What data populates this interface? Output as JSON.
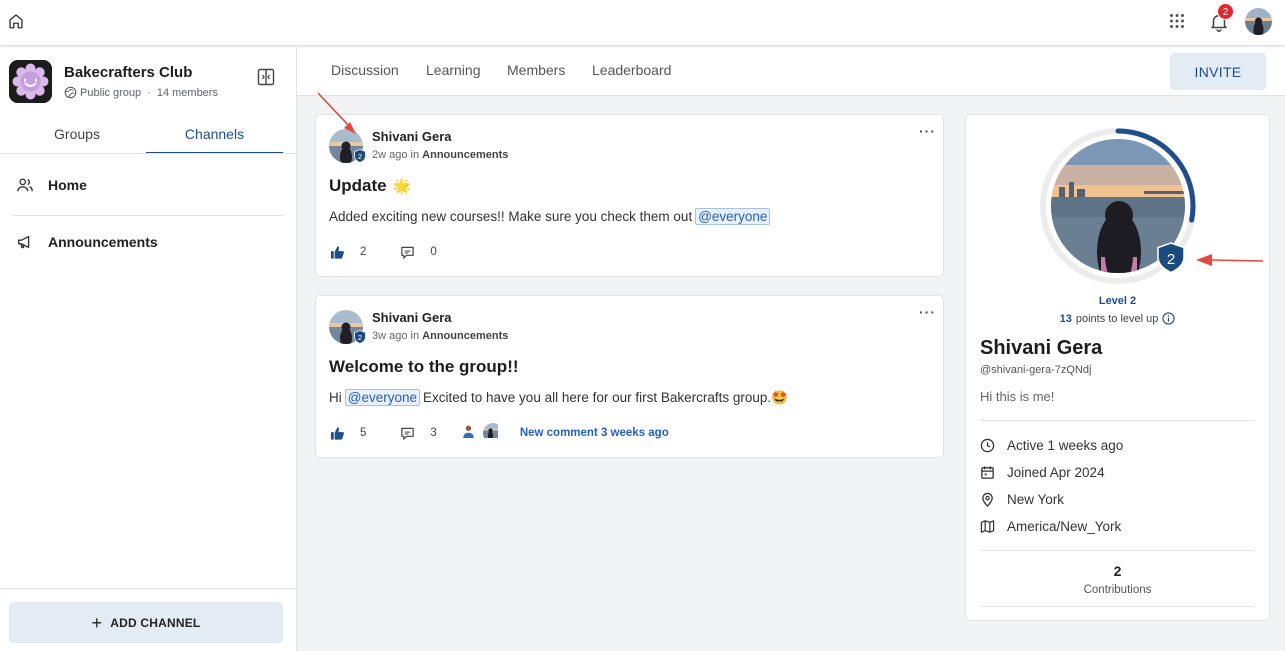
{
  "topbar": {
    "notification_count": "2"
  },
  "icons": {
    "home": "home-icon",
    "apps": "apps-grid-icon",
    "bell": "bell-icon",
    "globe": "globe-icon",
    "collapse": "collapse-panel-icon",
    "members": "users-icon",
    "announcements": "megaphone-icon",
    "like": "thumbs-up-icon",
    "comment": "comment-icon",
    "info": "info-icon",
    "activity": "clock-icon",
    "joined": "calendar-icon",
    "location": "location-pin-icon",
    "timezone": "map-icon"
  },
  "sidebar": {
    "club_name": "Bakecrafters Club",
    "privacy": "Public group",
    "dot": "·",
    "members": "14 members",
    "tabs": [
      {
        "label": "Groups"
      },
      {
        "label": "Channels",
        "active": true
      }
    ],
    "items": [
      {
        "label": "Home"
      },
      {
        "label": "Announcements"
      }
    ],
    "add_channel": "ADD CHANNEL",
    "add_symbol": "+"
  },
  "header": {
    "tabs": [
      {
        "label": "Discussion"
      },
      {
        "label": "Learning"
      },
      {
        "label": "Members"
      },
      {
        "label": "Leaderboard"
      }
    ],
    "invite": "INVITE"
  },
  "posts": [
    {
      "author": "Shivani Gera",
      "time": "2w ago",
      "in": "in",
      "channel": "Announcements",
      "title": "Update",
      "title_emoji": "🌟",
      "body_text": "Added exciting new courses!! Make sure you check them out",
      "mention": "@everyone",
      "likes": "2",
      "comments": "0",
      "more": "···",
      "badge_level": "2"
    },
    {
      "author": "Shivani Gera",
      "time": "3w ago",
      "in": "in",
      "channel": "Announcements",
      "title": "Welcome to the group!!",
      "body_prefix": "Hi",
      "mention": "@everyone",
      "body_text": "Excited to have you all here for our first Bakercrafts group.🤩",
      "likes": "5",
      "comments": "3",
      "new_comment": "New comment 3 weeks ago",
      "more": "···",
      "badge_level": "2"
    }
  ],
  "profile": {
    "badge_level": "2",
    "level": "Level 2",
    "points_number": "13",
    "points_text": "points to level up",
    "level_progress": 0.28,
    "name": "Shivani Gera",
    "handle": "@shivani-gera-7zQNdj",
    "bio": "Hi this is me!",
    "active": "Active 1 weeks ago",
    "joined": "Joined Apr 2024",
    "location": "New York",
    "timezone": "America/New_York",
    "contributions_count": "2",
    "contributions_label": "Contributions"
  },
  "colors": {
    "accent": "#1e4e8c",
    "badge": "#1b4b7e",
    "notification": "#e0282e",
    "annotation_arrow": "#e2483d",
    "mention_bg": "#e8f0fb"
  }
}
